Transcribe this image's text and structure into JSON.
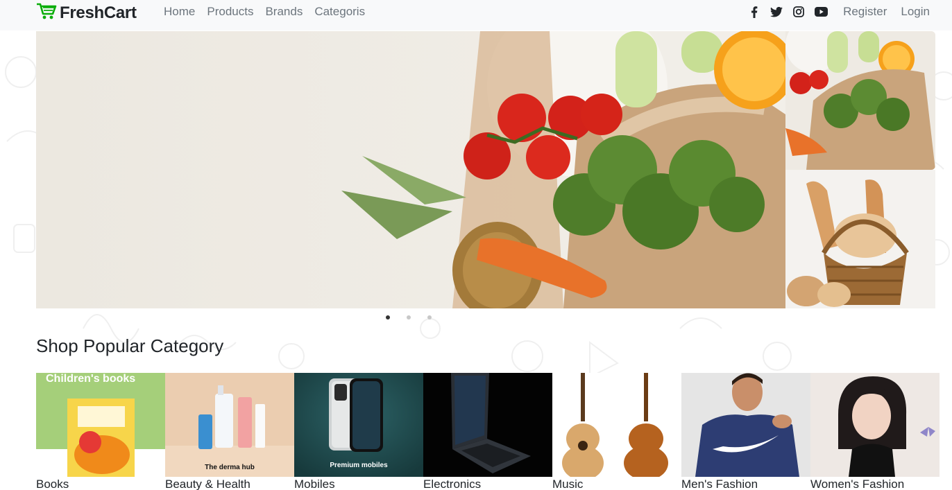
{
  "brand": {
    "name": "FreshCart",
    "accent": "#0aad0a"
  },
  "nav": {
    "links": [
      "Home",
      "Products",
      "Brands",
      "Categoris"
    ],
    "social_icons": [
      "facebook-icon",
      "twitter-icon",
      "instagram-icon",
      "youtube-icon"
    ],
    "register": "Register",
    "login": "Login"
  },
  "slider": {
    "slide_count": 3,
    "active_slide": 1
  },
  "section": {
    "title": "Shop Popular Category"
  },
  "categories": [
    {
      "label": "Books",
      "banner": "Children's books",
      "caption": ""
    },
    {
      "label": "Beauty & Health",
      "banner": "",
      "caption": "The derma hub"
    },
    {
      "label": "Mobiles",
      "banner": "",
      "caption": "Premium mobiles"
    },
    {
      "label": "Electronics",
      "banner": "",
      "caption": ""
    },
    {
      "label": "Music",
      "banner": "",
      "caption": ""
    },
    {
      "label": "Men's Fashion",
      "banner": "",
      "caption": ""
    },
    {
      "label": "Women's Fashion",
      "banner": "",
      "caption": ""
    }
  ]
}
